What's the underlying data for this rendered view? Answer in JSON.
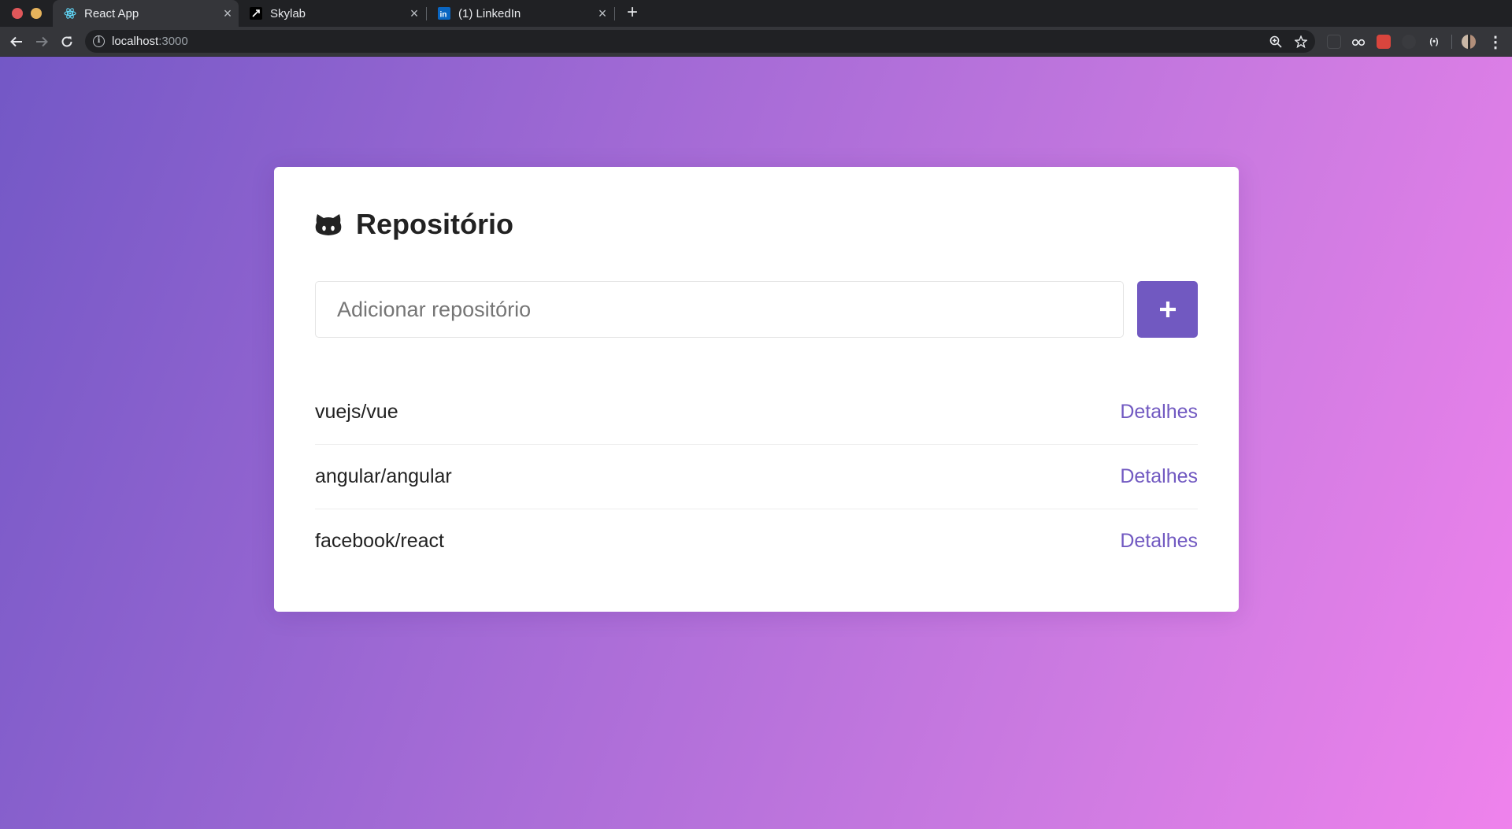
{
  "browser": {
    "tabs": [
      {
        "title": "React App",
        "active": true,
        "favicon": "react-icon"
      },
      {
        "title": "Skylab",
        "active": false,
        "favicon": "skylab-icon"
      },
      {
        "title": "(1) LinkedIn",
        "active": false,
        "favicon": "linkedin-icon"
      }
    ],
    "url_host": "localhost",
    "url_port": ":3000"
  },
  "page": {
    "title": "Repositório",
    "input": {
      "value": "",
      "placeholder": "Adicionar repositório"
    },
    "add_button_icon": "plus-icon",
    "repositories": [
      {
        "name": "vuejs/vue",
        "link": "Detalhes"
      },
      {
        "name": "angular/angular",
        "link": "Detalhes"
      },
      {
        "name": "facebook/react",
        "link": "Detalhes"
      }
    ]
  },
  "colors": {
    "accent": "#7159c1",
    "gradient_start": "#7358c6",
    "gradient_end": "#ef82ec"
  }
}
